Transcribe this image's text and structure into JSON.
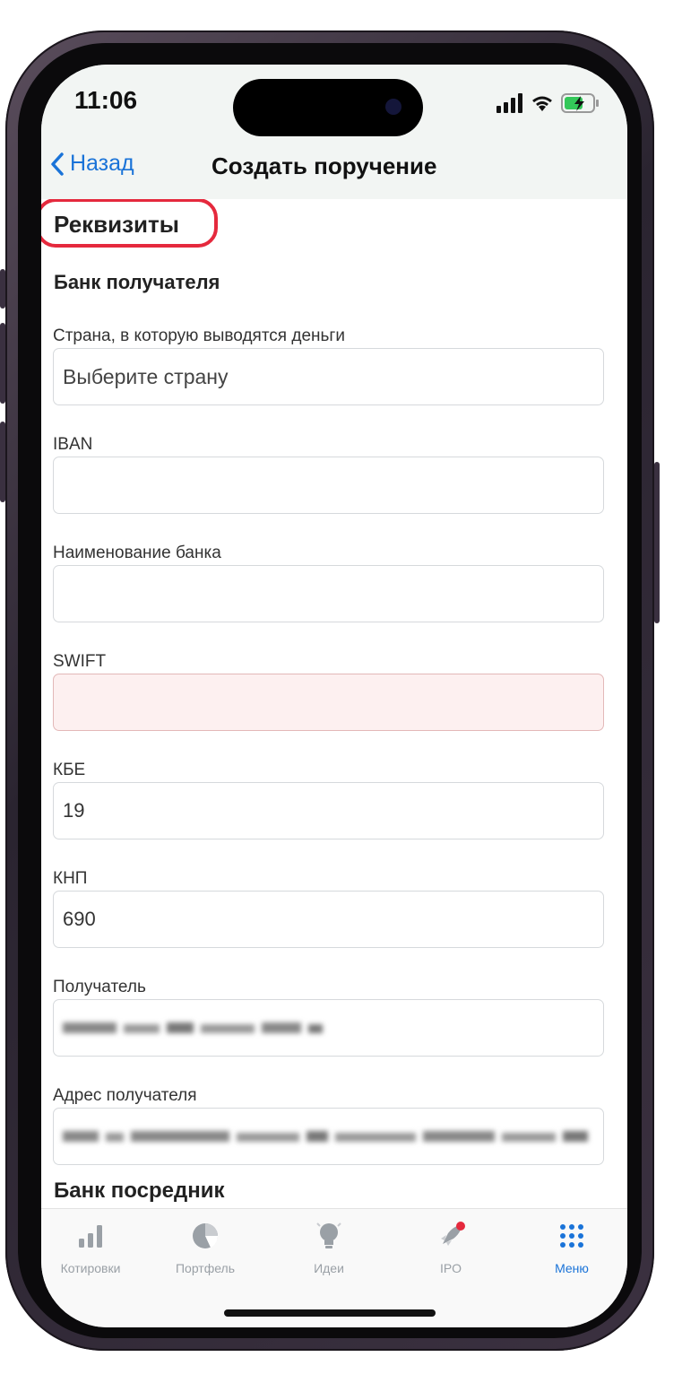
{
  "status_bar": {
    "time": "11:06"
  },
  "nav": {
    "back_label": "Назад",
    "title": "Создать поручение"
  },
  "form": {
    "section_title": "Реквизиты",
    "bank_recipient_title": "Банк получателя",
    "country": {
      "label": "Страна, в которую выводятся деньги",
      "value": "Выберите страну"
    },
    "iban": {
      "label": "IBAN",
      "value": ""
    },
    "bank_name": {
      "label": "Наименование банка",
      "value": ""
    },
    "swift": {
      "label": "SWIFT",
      "value": ""
    },
    "kbe": {
      "label": "КБЕ",
      "value": "19"
    },
    "knp": {
      "label": "КНП",
      "value": "690"
    },
    "recipient": {
      "label": "Получатель"
    },
    "recipient_address": {
      "label": "Адрес получателя"
    },
    "intermediary_title": "Банк посредник"
  },
  "tabs": [
    {
      "label": "Котировки",
      "icon": "bar-chart-icon",
      "active": false
    },
    {
      "label": "Портфель",
      "icon": "pie-chart-icon",
      "active": false
    },
    {
      "label": "Идеи",
      "icon": "lightbulb-icon",
      "active": false
    },
    {
      "label": "IPO",
      "icon": "rocket-icon",
      "active": false
    },
    {
      "label": "Меню",
      "icon": "grid-menu-icon",
      "active": true
    }
  ],
  "colors": {
    "accent": "#1a73d8",
    "highlight_red": "#e5293d",
    "error_field_bg": "#fdf0f0",
    "notification_dot": "#e5293d"
  }
}
